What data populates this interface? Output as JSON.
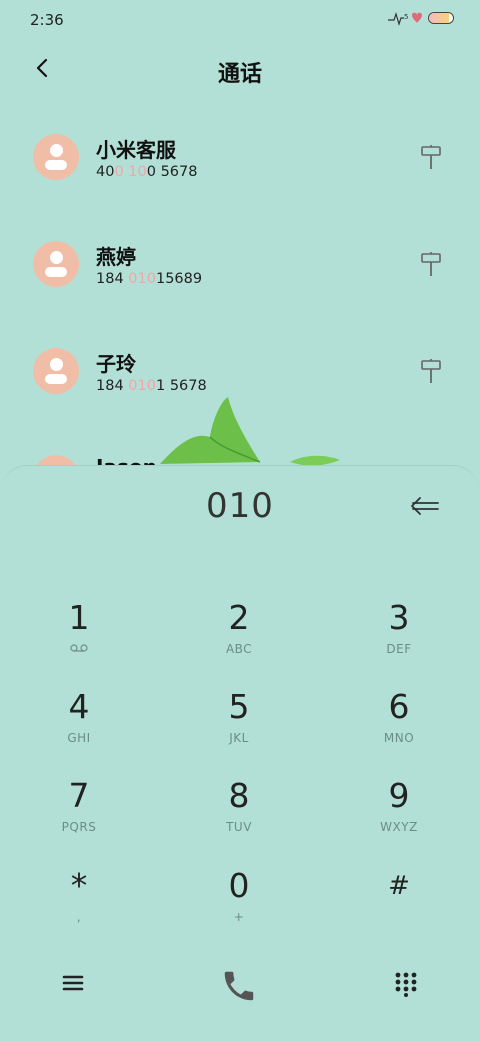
{
  "status_bar": {
    "time": "2:36",
    "notification_count": "5",
    "battery_level": 0.85
  },
  "header": {
    "title": "通话"
  },
  "contacts": [
    {
      "name": "小米客服",
      "number_parts": [
        "40",
        "0 10",
        "0 5678"
      ]
    },
    {
      "name": "燕婷",
      "number_parts": [
        "184 ",
        "010",
        "15689"
      ]
    },
    {
      "name": "子玲",
      "number_parts": [
        "184 ",
        "010",
        "1 5678"
      ]
    },
    {
      "name": "Jason",
      "number_parts": [
        "",
        "",
        ""
      ]
    }
  ],
  "dialer": {
    "dialed": "010",
    "keys": [
      {
        "digit": "1",
        "letters": "",
        "icon": "voicemail-icon"
      },
      {
        "digit": "2",
        "letters": "ABC"
      },
      {
        "digit": "3",
        "letters": "DEF"
      },
      {
        "digit": "4",
        "letters": "GHI"
      },
      {
        "digit": "5",
        "letters": "JKL"
      },
      {
        "digit": "6",
        "letters": "MNO"
      },
      {
        "digit": "7",
        "letters": "PQRS"
      },
      {
        "digit": "8",
        "letters": "TUV"
      },
      {
        "digit": "9",
        "letters": "WXYZ"
      },
      {
        "digit": "*",
        "letters": ","
      },
      {
        "digit": "0",
        "letters": "+"
      },
      {
        "digit": "#",
        "letters": ""
      }
    ]
  },
  "colors": {
    "background": "#b3e0d6",
    "avatar": "#f0bea6",
    "highlight": "#f2a6a6",
    "call_button": "#555555"
  },
  "icons": {
    "back": "chevron-left-icon",
    "contact_action": "signpost-icon",
    "backspace": "backspace-arrow-icon",
    "menu": "menu-icon",
    "call": "phone-icon",
    "keypad": "keypad-grid-icon"
  }
}
